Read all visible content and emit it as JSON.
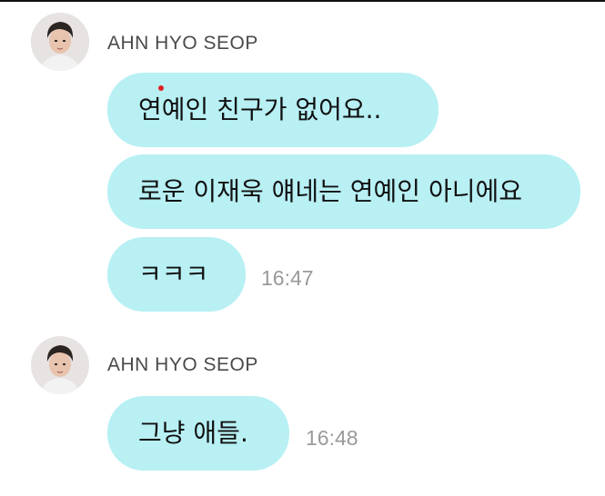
{
  "chat": {
    "groups": [
      {
        "sender": "AHN HYO SEOP",
        "messages": [
          {
            "text": "연예인 친구가 없어요..",
            "time": ""
          },
          {
            "text": "로운 이재욱 얘네는 연예인 아니에요",
            "time": ""
          },
          {
            "text": "ㅋㅋㅋ",
            "time": "16:47"
          }
        ]
      },
      {
        "sender": "AHN HYO SEOP",
        "messages": [
          {
            "text": "그냥 애들.",
            "time": "16:48"
          }
        ]
      }
    ]
  },
  "colors": {
    "bubble_bg": "#b8f0f4",
    "sender_name": "#4a4a4a",
    "timestamp": "#9a9a9a",
    "background": "#ffffff"
  },
  "icons": {
    "avatar": "profile-photo"
  }
}
